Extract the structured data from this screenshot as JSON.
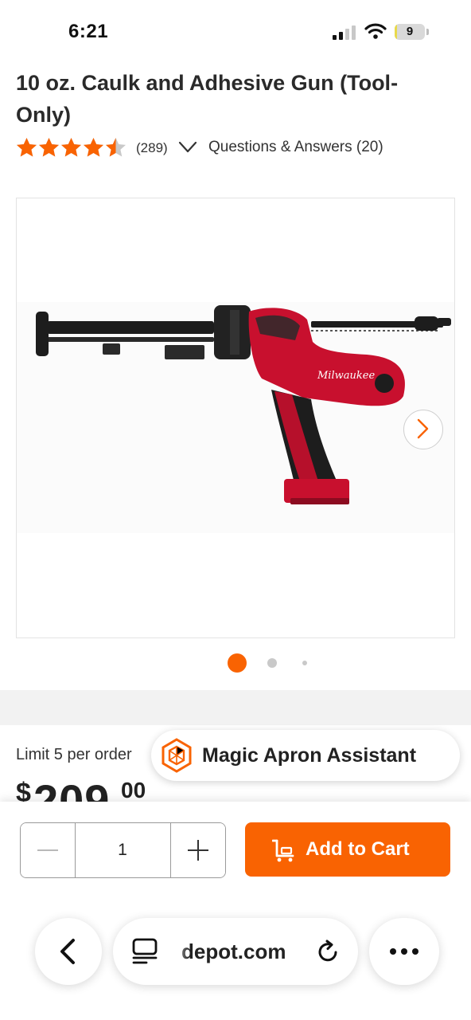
{
  "status_bar": {
    "time": "6:21",
    "battery": "9",
    "battery_fill_fraction": 0.09
  },
  "product": {
    "title": "10 oz. Caulk and Adhesive Gun (Tool-Only)",
    "rating": 4.5,
    "review_count": "(289)",
    "qa_link": "Questions & Answers (20)",
    "image_count": 3,
    "active_image_index": 1,
    "brand_on_tool": "Milwaukee"
  },
  "pricing": {
    "limit": "Limit 5 per order",
    "currency": "$",
    "dollars": "209",
    "cents": "00"
  },
  "assistant": {
    "label": "Magic Apron Assistant"
  },
  "cart": {
    "quantity": "1",
    "add_label": "Add to Cart"
  },
  "browser": {
    "url": "depot.com"
  },
  "colors": {
    "accent": "#f96302",
    "star": "#f96302",
    "tool_red": "#c8102e",
    "tool_black": "#1d1d1d"
  },
  "icons": {
    "signal": "cellular-signal-icon",
    "wifi": "wifi-icon",
    "cart": "cart-icon",
    "back": "chevron-left-icon",
    "reader": "reader-mode-icon",
    "reload": "reload-icon",
    "more": "more-dots-icon",
    "next": "chevron-right-icon",
    "assistant": "magic-apron-icon"
  }
}
